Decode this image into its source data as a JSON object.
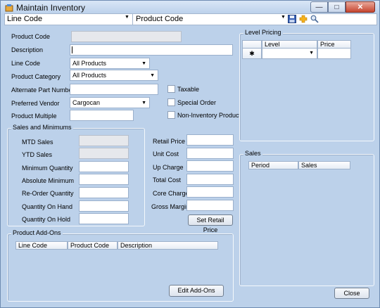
{
  "window": {
    "title": "Maintain Inventory",
    "minimize_glyph": "—",
    "maximize_glyph": "□",
    "close_glyph": "✕"
  },
  "toolbar": {
    "line_code_label": "Line Code",
    "product_code_label": "Product Code",
    "dropdown_glyph": "▼",
    "icons": [
      "save-icon",
      "add-icon",
      "search-icon"
    ]
  },
  "form": {
    "product_code_label": "Product Code",
    "product_code_value": "",
    "description_label": "Description",
    "description_value": "",
    "line_code_label": "Line Code",
    "line_code_value": "All Products",
    "product_category_label": "Product Category",
    "product_category_value": "All Products",
    "alternate_part_label": "Alternate Part Number",
    "preferred_vendor_label": "Preferred Vendor",
    "preferred_vendor_value": "Cargocan",
    "product_multiple_label": "Product Multiple",
    "taxable_label": "Taxable",
    "special_order_label": "Special Order",
    "non_inventory_label": "Non-Inventory Product"
  },
  "sales_and_minimums": {
    "title": "Sales and Minimums",
    "mtd_label": "MTD Sales",
    "ytd_label": "YTD Sales",
    "min_qty_label": "Minimum Quantity",
    "abs_min_label": "Absolute Minimum",
    "reorder_label": "Re-Order Quantity",
    "on_hand_label": "Quantity On Hand",
    "on_hold_label": "Quantity On Hold"
  },
  "pricing": {
    "retail_price_label": "Retail Price",
    "unit_cost_label": "Unit Cost",
    "up_charge_label": "Up Charge",
    "total_cost_label": "Total Cost",
    "core_charge_label": "Core Charge",
    "gross_margin_label": "Gross Margin",
    "set_retail_button": "Set Retail Price"
  },
  "level_pricing": {
    "title": "Level Pricing",
    "columns": [
      "Level",
      "Price"
    ],
    "new_row_marker": "✱"
  },
  "sales": {
    "title": "Sales",
    "columns": [
      "Period",
      "Sales"
    ]
  },
  "addons": {
    "title": "Product Add-Ons",
    "columns": [
      "Line Code",
      "Product Code",
      "Description"
    ],
    "edit_button": "Edit Add-Ons"
  },
  "close_button": "Close",
  "colors": {
    "background": "#bcd1ea",
    "border": "#9ab0cc"
  }
}
